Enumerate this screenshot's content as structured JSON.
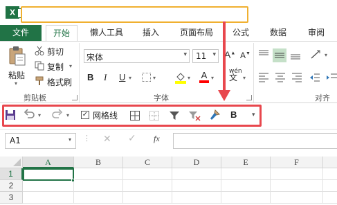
{
  "ribbon": {
    "tabs": [
      "文件",
      "开始",
      "懒人工具",
      "插入",
      "页面布局",
      "公式",
      "数据",
      "审阅"
    ],
    "clipboard": {
      "paste": "粘贴",
      "cut": "剪切",
      "copy": "复制",
      "format_painter": "格式刷",
      "group_label": "剪贴板"
    },
    "font": {
      "name": "宋体",
      "size": "11",
      "bold": "B",
      "italic": "I",
      "underline": "U",
      "phonetic": "wén",
      "group_label": "字体"
    },
    "alignment": {
      "group_label": "对齐方"
    }
  },
  "qat": {
    "gridlines_label": "网格线",
    "bold_label": "B",
    "gridlines_checked": true
  },
  "formula_bar": {
    "name_box": "A1",
    "fx": "fx",
    "formula": ""
  },
  "sheet": {
    "columns": [
      "A",
      "B",
      "C",
      "D",
      "E",
      "F"
    ],
    "rows": [
      "1",
      "2",
      "3"
    ],
    "active_cell": "A1"
  },
  "colors": {
    "excel_green": "#217346",
    "annotation_red": "#e8474d",
    "highlight_orange": "#f0b030"
  }
}
